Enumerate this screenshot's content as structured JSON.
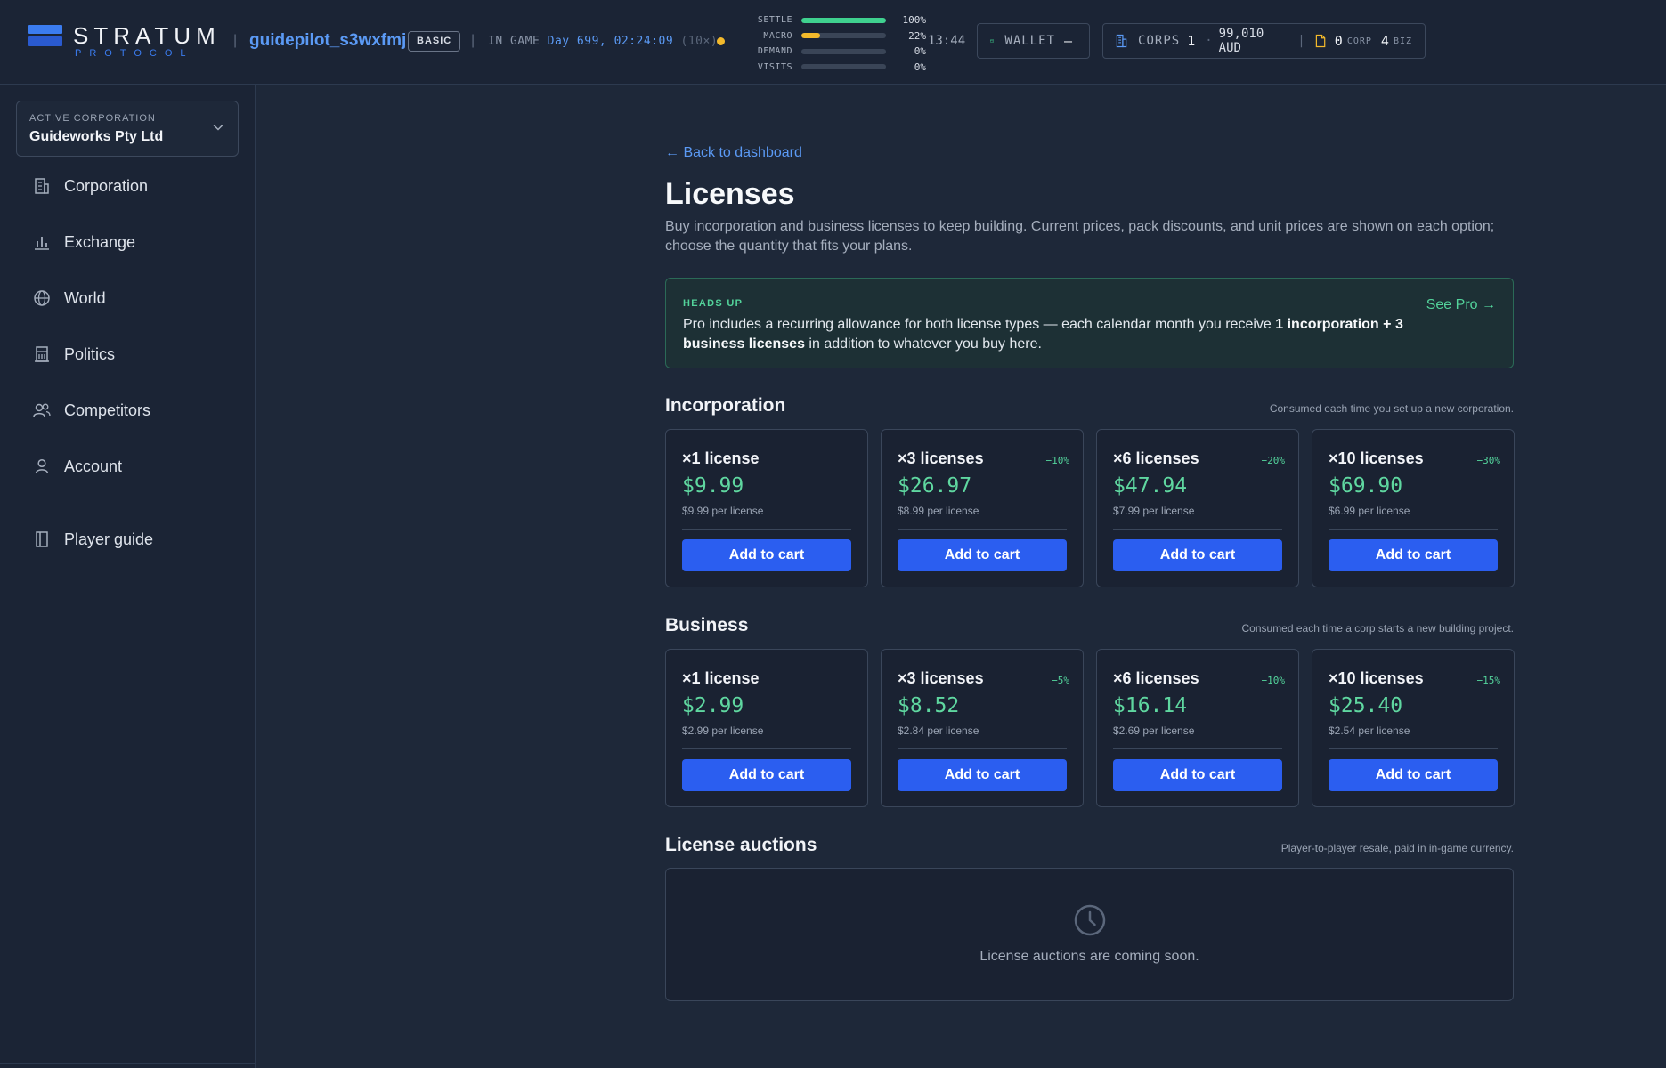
{
  "header": {
    "brand_title": "STRATUM",
    "brand_subtitle": "PROTOCOL",
    "username": "guidepilot_s3wxfmj",
    "plan": "BASIC",
    "ingame_label": "IN GAME",
    "ingame_time": "Day 699, 02:24:09",
    "ingame_speed": "(10×)",
    "meters": [
      {
        "label": "SETTLE",
        "value": "100%",
        "fraction": 1.0,
        "color": "#3fd18f"
      },
      {
        "label": "MACRO",
        "value": "22%",
        "fraction": 0.22,
        "color": "#f3b92b"
      },
      {
        "label": "DEMAND",
        "value": "0%",
        "fraction": 0.0,
        "color": "#3fd18f"
      },
      {
        "label": "VISITS",
        "value": "0%",
        "fraction": 0.0,
        "color": "#3fd18f"
      }
    ],
    "clock": "13:44",
    "wallet_label": "WALLET",
    "wallet_value": "–",
    "corps_label": "CORPS",
    "corps_count": "1",
    "corps_balance": "99,010 AUD",
    "corp_licenses": "0",
    "corp_licenses_label": "CORP",
    "biz_licenses": "4",
    "biz_licenses_label": "BIZ"
  },
  "sidebar": {
    "active_corp_label": "ACTIVE CORPORATION",
    "active_corp_value": "Guideworks Pty Ltd",
    "items": [
      {
        "label": "Corporation",
        "icon": "building-icon"
      },
      {
        "label": "Exchange",
        "icon": "bar-chart-icon"
      },
      {
        "label": "World",
        "icon": "globe-icon"
      },
      {
        "label": "Politics",
        "icon": "capitol-icon"
      },
      {
        "label": "Competitors",
        "icon": "users-icon"
      },
      {
        "label": "Account",
        "icon": "user-icon"
      }
    ],
    "guide": {
      "label": "Player guide",
      "icon": "book-icon"
    }
  },
  "main": {
    "back_link": "← Back to dashboard",
    "title": "Licenses",
    "description": "Buy incorporation and business licenses to keep building. Current prices, pack discounts, and unit prices are shown on each option; choose the quantity that fits your plans.",
    "alert": {
      "tag": "HEADS UP",
      "text_before": "Pro includes a recurring allowance for both license types — each calendar month you receive ",
      "text_bold": "1 incorporation + 3 business licenses",
      "text_after": " in addition to whatever you buy here.",
      "link": "See Pro →"
    },
    "incorporation": {
      "title": "Incorporation",
      "note": "Consumed each time you set up a new corporation.",
      "cards": [
        {
          "qty": "×1 license",
          "discount": "",
          "price": "$9.99",
          "unit": "$9.99 per license",
          "button": "Add to cart"
        },
        {
          "qty": "×3 licenses",
          "discount": "−10%",
          "price": "$26.97",
          "unit": "$8.99 per license",
          "button": "Add to cart"
        },
        {
          "qty": "×6 licenses",
          "discount": "−20%",
          "price": "$47.94",
          "unit": "$7.99 per license",
          "button": "Add to cart"
        },
        {
          "qty": "×10 licenses",
          "discount": "−30%",
          "price": "$69.90",
          "unit": "$6.99 per license",
          "button": "Add to cart"
        }
      ]
    },
    "business": {
      "title": "Business",
      "note": "Consumed each time a corp starts a new building project.",
      "cards": [
        {
          "qty": "×1 license",
          "discount": "",
          "price": "$2.99",
          "unit": "$2.99 per license",
          "button": "Add to cart"
        },
        {
          "qty": "×3 licenses",
          "discount": "−5%",
          "price": "$8.52",
          "unit": "$2.84 per license",
          "button": "Add to cart"
        },
        {
          "qty": "×6 licenses",
          "discount": "−10%",
          "price": "$16.14",
          "unit": "$2.69 per license",
          "button": "Add to cart"
        },
        {
          "qty": "×10 licenses",
          "discount": "−15%",
          "price": "$25.40",
          "unit": "$2.54 per license",
          "button": "Add to cart"
        }
      ]
    },
    "auctions": {
      "title": "License auctions",
      "note": "Player-to-player resale, paid in in-game currency.",
      "message": "License auctions are coming soon."
    }
  }
}
